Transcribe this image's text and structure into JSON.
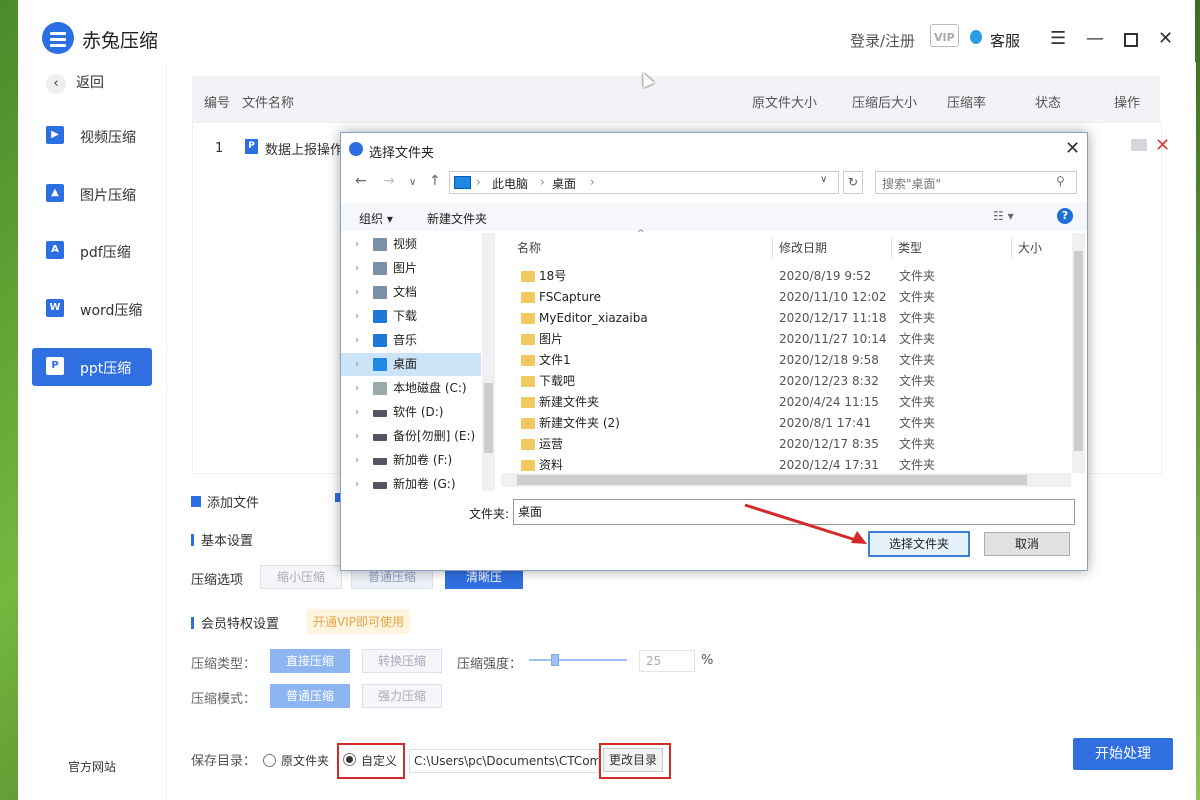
{
  "app": {
    "title": "赤兔压缩",
    "login": "登录/注册",
    "vip": "VIP",
    "service": "客服"
  },
  "sidebar": {
    "back": "返回",
    "items": [
      {
        "label": "视频压缩",
        "icon": "video-icon",
        "glyph": "▶"
      },
      {
        "label": "图片压缩",
        "icon": "image-icon",
        "glyph": "▲"
      },
      {
        "label": "pdf压缩",
        "icon": "pdf-icon",
        "glyph": "A"
      },
      {
        "label": "word压缩",
        "icon": "word-icon",
        "glyph": "W"
      },
      {
        "label": "ppt压缩",
        "icon": "ppt-icon",
        "glyph": "P"
      }
    ],
    "footer": "官方网站"
  },
  "table": {
    "headers": [
      "编号",
      "文件名称",
      "原文件大小",
      "压缩后大小",
      "压缩率",
      "状态",
      "操作"
    ],
    "rows": [
      {
        "num": "1",
        "name": "数据上报操作"
      }
    ]
  },
  "actions": {
    "add_file": "添加文件"
  },
  "basic": {
    "title": "基本设置",
    "option_label": "压缩选项",
    "options": [
      "缩小压缩",
      "普通压缩",
      "清晰压缩"
    ]
  },
  "vip_settings": {
    "title": "会员特权设置",
    "tag": "开通VIP即可使用",
    "type_label": "压缩类型：",
    "types": [
      "直接压缩",
      "转换压缩"
    ],
    "strength_label": "压缩强度：",
    "strength_value": "25",
    "strength_unit": "%",
    "strength_level": 0.25,
    "mode_label": "压缩模式：",
    "modes": [
      "普通压缩",
      "强力压缩"
    ]
  },
  "save": {
    "label": "保存目录：",
    "original": "原文件夹",
    "custom": "自定义",
    "path": "C:\\Users\\pc\\Documents\\CTCom",
    "change": "更改目录"
  },
  "start_button": "开始处理",
  "dialog": {
    "title": "选择文件夹",
    "breadcrumb": [
      "此电脑",
      "桌面"
    ],
    "search_placeholder": "搜索\"桌面\"",
    "organize": "组织 ▾",
    "new_folder": "新建文件夹",
    "tree": [
      "视频",
      "图片",
      "文档",
      "下载",
      "音乐",
      "桌面",
      "本地磁盘 (C:)",
      "软件 (D:)",
      "备份[勿删] (E:)",
      "新加卷 (F:)",
      "新加卷 (G:)"
    ],
    "selected_tree": "桌面",
    "columns": [
      "名称",
      "修改日期",
      "类型",
      "大小"
    ],
    "files": [
      {
        "name": "18号",
        "date": "2020/8/19 9:52",
        "type": "文件夹"
      },
      {
        "name": "FSCapture",
        "date": "2020/11/10 12:02",
        "type": "文件夹"
      },
      {
        "name": "MyEditor_xiazaiba",
        "date": "2020/12/17 11:18",
        "type": "文件夹"
      },
      {
        "name": "图片",
        "date": "2020/11/27 10:14",
        "type": "文件夹"
      },
      {
        "name": "文件1",
        "date": "2020/12/18 9:58",
        "type": "文件夹"
      },
      {
        "name": "下载吧",
        "date": "2020/12/23 8:32",
        "type": "文件夹"
      },
      {
        "name": "新建文件夹",
        "date": "2020/4/24 11:15",
        "type": "文件夹"
      },
      {
        "name": "新建文件夹 (2)",
        "date": "2020/8/1 17:41",
        "type": "文件夹"
      },
      {
        "name": "运营",
        "date": "2020/12/17 8:35",
        "type": "文件夹"
      },
      {
        "name": "资料",
        "date": "2020/12/4 17:31",
        "type": "文件夹"
      }
    ],
    "folder_label": "文件夹:",
    "folder_value": "桌面",
    "ok": "选择文件夹",
    "cancel": "取消"
  }
}
